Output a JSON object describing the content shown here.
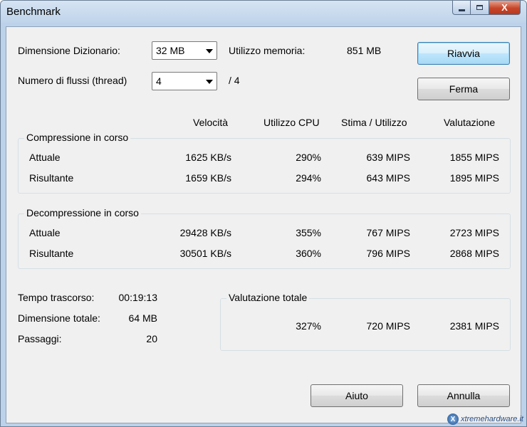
{
  "window": {
    "title": "Benchmark",
    "close_glyph": "X"
  },
  "settings": {
    "dictionary_label": "Dimensione Dizionario:",
    "dictionary_value": "32 MB",
    "threads_label": "Numero di flussi (thread)",
    "threads_value": "4",
    "threads_max": "/ 4",
    "memory_label": "Utilizzo memoria:",
    "memory_value": "851 MB"
  },
  "buttons": {
    "restart": "Riavvia",
    "stop": "Ferma",
    "help": "Aiuto",
    "cancel": "Annulla"
  },
  "columns": {
    "speed": "Velocità",
    "cpu": "Utilizzo CPU",
    "estimate": "Stima / Utilizzo",
    "rating": "Valutazione"
  },
  "compression": {
    "title": "Compressione in corso",
    "rows": [
      {
        "label": "Attuale",
        "speed": "1625 KB/s",
        "cpu": "290%",
        "estimate": "639 MIPS",
        "rating": "1855 MIPS"
      },
      {
        "label": "Risultante",
        "speed": "1659 KB/s",
        "cpu": "294%",
        "estimate": "643 MIPS",
        "rating": "1895 MIPS"
      }
    ]
  },
  "decompression": {
    "title": "Decompressione in corso",
    "rows": [
      {
        "label": "Attuale",
        "speed": "29428 KB/s",
        "cpu": "355%",
        "estimate": "767 MIPS",
        "rating": "2723 MIPS"
      },
      {
        "label": "Risultante",
        "speed": "30501 KB/s",
        "cpu": "360%",
        "estimate": "796 MIPS",
        "rating": "2868 MIPS"
      }
    ]
  },
  "stats": {
    "elapsed_label": "Tempo trascorso:",
    "elapsed_value": "00:19:13",
    "size_label": "Dimensione totale:",
    "size_value": "64 MB",
    "passes_label": "Passaggi:",
    "passes_value": "20"
  },
  "total": {
    "title": "Valutazione totale",
    "cpu": "327%",
    "estimate": "720 MIPS",
    "rating": "2381 MIPS"
  },
  "watermark": {
    "text": "xtremehardware.it",
    "logo_glyph": "X"
  }
}
